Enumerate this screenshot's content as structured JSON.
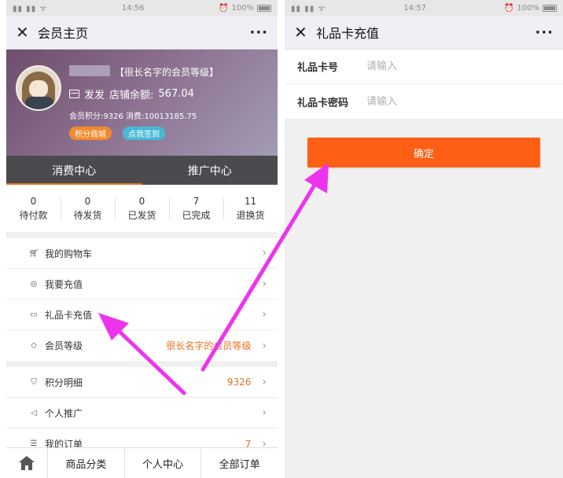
{
  "colors": {
    "accent_orange": "#ff5f14",
    "arrow_magenta": "#ee33ee",
    "tab_bg": "#4b4b4f",
    "level_value": "#e8711f"
  },
  "left": {
    "status": {
      "time": "14:56",
      "battery": "100%"
    },
    "nav": {
      "close_icon": "close-icon",
      "title": "会员主页",
      "more": "···"
    },
    "profile": {
      "level_tag": "【很长名字的会员等级】",
      "store_prefix": "发发",
      "balance_label": "店铺余额:",
      "balance_value": "567.04",
      "points_line": "会员积分:9326  消费:10013185.75",
      "btn_points_mall": "积分商城",
      "btn_checkin": "点我签到"
    },
    "tabs": [
      {
        "label": "消费中心",
        "active": true
      },
      {
        "label": "推广中心",
        "active": false
      }
    ],
    "orders": [
      {
        "num": "0",
        "label": "待付款"
      },
      {
        "num": "0",
        "label": "待发货"
      },
      {
        "num": "0",
        "label": "已发货"
      },
      {
        "num": "7",
        "label": "已完成"
      },
      {
        "num": "11",
        "label": "退换货"
      }
    ],
    "menu": [
      {
        "icon": "cart-icon",
        "label": "我的购物车",
        "value": ""
      },
      {
        "icon": "recharge-icon",
        "label": "我要充值",
        "value": ""
      },
      {
        "icon": "gift-card-icon",
        "label": "礼品卡充值",
        "value": ""
      },
      {
        "icon": "diamond-icon",
        "label": "会员等级",
        "value": "很长名字的会员等级"
      },
      {
        "icon": "points-icon",
        "label": "积分明细",
        "value": "9326"
      },
      {
        "icon": "megaphone-icon",
        "label": "个人推广",
        "value": ""
      },
      {
        "icon": "order-list-icon",
        "label": "我的订单",
        "value": "7"
      }
    ],
    "tabbar": [
      "商品分类",
      "个人中心",
      "全部订单"
    ]
  },
  "right": {
    "status": {
      "time": "14:57",
      "battery": "100%"
    },
    "nav": {
      "title": "礼品卡充值",
      "more": "···"
    },
    "form": {
      "card_number_label": "礼品卡号",
      "card_number_placeholder": "请输入",
      "card_password_label": "礼品卡密码",
      "card_password_placeholder": "请输入"
    },
    "confirm_label": "确定"
  }
}
